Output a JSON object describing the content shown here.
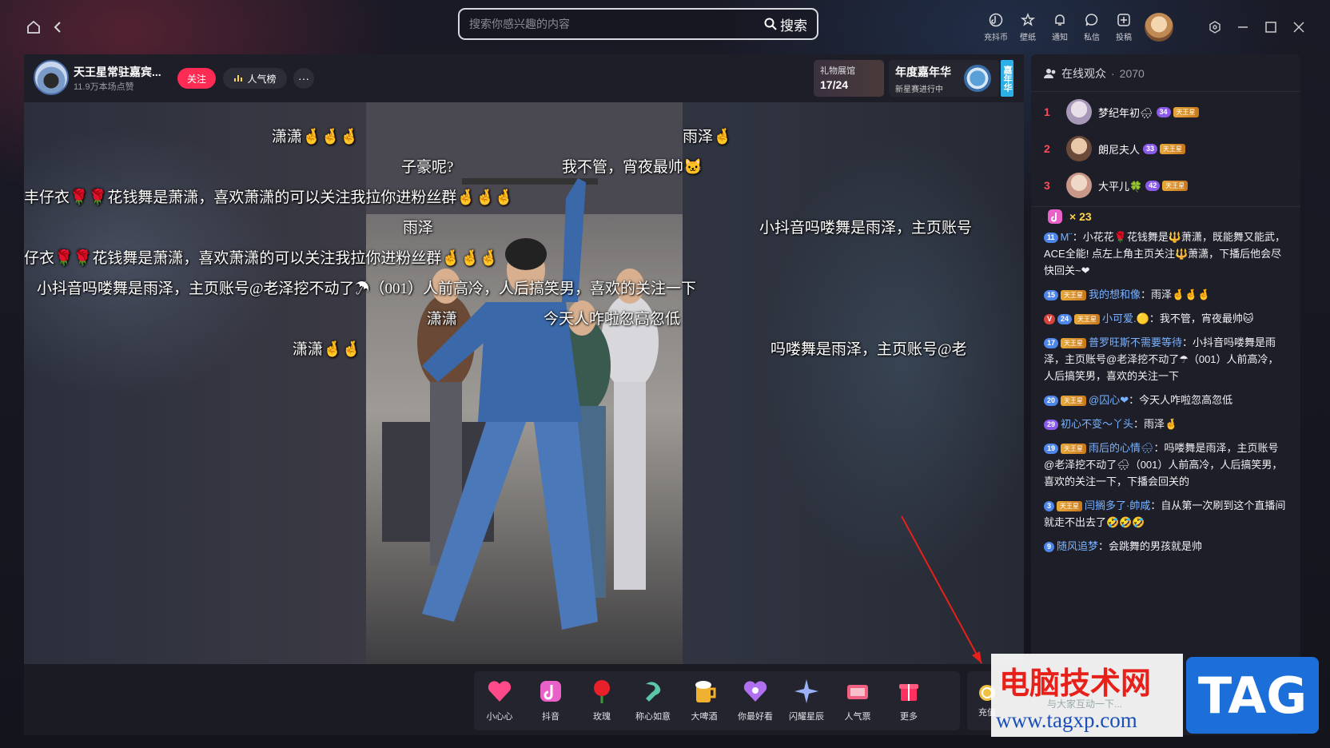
{
  "topbar": {
    "search_placeholder": "搜索你感兴趣的内容",
    "search_label": "搜索",
    "icons": [
      {
        "label": "充抖币",
        "icon": "douyin-coin-icon"
      },
      {
        "label": "壁纸",
        "icon": "wallpaper-icon"
      },
      {
        "label": "通知",
        "icon": "bell-icon"
      },
      {
        "label": "私信",
        "icon": "message-icon"
      },
      {
        "label": "投稿",
        "icon": "upload-icon"
      }
    ]
  },
  "host": {
    "name": "天王星常驻嘉宾...",
    "likes": "11.9万本场点赞",
    "follow_label": "关注",
    "popularity_label": "人气榜",
    "more_label": "···"
  },
  "banners": {
    "gift_hall_title": "礼物展馆",
    "gift_hall_progress": "17/24",
    "carnival_title": "年度嘉年华",
    "carnival_sub": "新星赛进行中",
    "carnival_tag": "嘉年华"
  },
  "danmaku": [
    "潇潇🤞🤞🤞",
    "雨泽🤞",
    "子豪呢?",
    "我不管，宵夜最帅🐱",
    "丰仔衣🌹🌹花钱舞是萧潇，喜欢萧潇的可以关注我拉你进粉丝群🤞🤞🤞",
    "雨泽",
    "小抖音吗喽舞是雨泽，主页账号",
    "仔衣🌹🌹花钱舞是萧潇，喜欢萧潇的可以关注我拉你进粉丝群🤞🤞🤞",
    "小抖音吗喽舞是雨泽，主页账号@老泽挖不动了☂（001）人前高冷，人后搞笑男，喜欢的关注一下",
    "潇潇",
    "今天人咋啦忽高忽低",
    "潇潇🤞🤞",
    "吗喽舞是雨泽，主页账号@老"
  ],
  "gifts": [
    {
      "label": "小心心",
      "icon": "heart-gift-icon",
      "color": "#ff4a8a"
    },
    {
      "label": "抖音",
      "icon": "douyin-gift-icon",
      "color": "#e860c8"
    },
    {
      "label": "玫瑰",
      "icon": "rose-gift-icon",
      "color": "#e8202a"
    },
    {
      "label": "称心如意",
      "icon": "ruyi-gift-icon",
      "color": "#5ac8a8"
    },
    {
      "label": "大啤酒",
      "icon": "beer-gift-icon",
      "color": "#f0b030"
    },
    {
      "label": "你最好看",
      "icon": "beauty-gift-icon",
      "color": "#b070f0"
    },
    {
      "label": "闪耀星辰",
      "icon": "star-gift-icon",
      "color": "#9ab0f8"
    },
    {
      "label": "人气票",
      "icon": "ticket-gift-icon",
      "color": "#f06080"
    },
    {
      "label": "更多",
      "icon": "more-gift-icon",
      "color": "#ff3060"
    }
  ],
  "recharge_label": "充值",
  "audience": {
    "label": "在线观众",
    "count": "2070",
    "ranks": [
      {
        "rank": "1",
        "name": "梦纪年初🌧",
        "level": "34",
        "fan": "天王星"
      },
      {
        "rank": "2",
        "name": "朗尼夫人",
        "level": "33",
        "fan": "天王星"
      },
      {
        "rank": "3",
        "name": "大平儿🍀",
        "level": "42",
        "fan": "天王星"
      }
    ]
  },
  "gift_counter": "× 23",
  "chat": [
    {
      "level": "11",
      "fan": "",
      "user": "M¨",
      "text": "：小花花🌹花钱舞是🔱萧潇，既能舞又能武，ACE全能! 点左上角主页关注🔱萧潇，下播后他会尽快回关~❤"
    },
    {
      "level": "15",
      "fan": "天王星",
      "user": "我的想和像",
      "text": "：雨泽🤞🤞🤞"
    },
    {
      "level": "24",
      "fan": "天王星",
      "user": "小可爱.🟡",
      "text": "：我不管，宵夜最帅🐱",
      "badge": "V"
    },
    {
      "level": "17",
      "fan": "天王星",
      "user": "普罗旺斯不需要等待",
      "text": "：小抖音吗喽舞是雨泽，主页账号@老泽挖不动了☂（001）人前高冷，人后搞笑男，喜欢的关注一下"
    },
    {
      "level": "20",
      "fan": "天王星",
      "user": "@囚心❤",
      "text": "：今天人咋啦忽高忽低"
    },
    {
      "level": "29",
      "fan": "",
      "user": "初心不变～丫头",
      "text": "：雨泽🤞"
    },
    {
      "level": "19",
      "fan": "天王星",
      "user": "雨后的心情🌧",
      "text": "：吗喽舞是雨泽，主页账号@老泽挖不动了🌧（001）人前高冷，人后搞笑男，喜欢的关注一下，下播会回关的"
    },
    {
      "level": "3",
      "fan": "天王星",
      "user": "闫搁多了·帥咸",
      "text": "：自从第一次刷到这个直播间就走不出去了🤣🤣🤣"
    },
    {
      "level": "9",
      "fan": "",
      "user": "随风追梦",
      "text": "：会跳舞的男孩就是帅"
    }
  ],
  "watermark": {
    "title": "电脑技术网",
    "sub": "与大家互动一下...",
    "url": "www.tagxp.com",
    "tag": "TAG"
  }
}
